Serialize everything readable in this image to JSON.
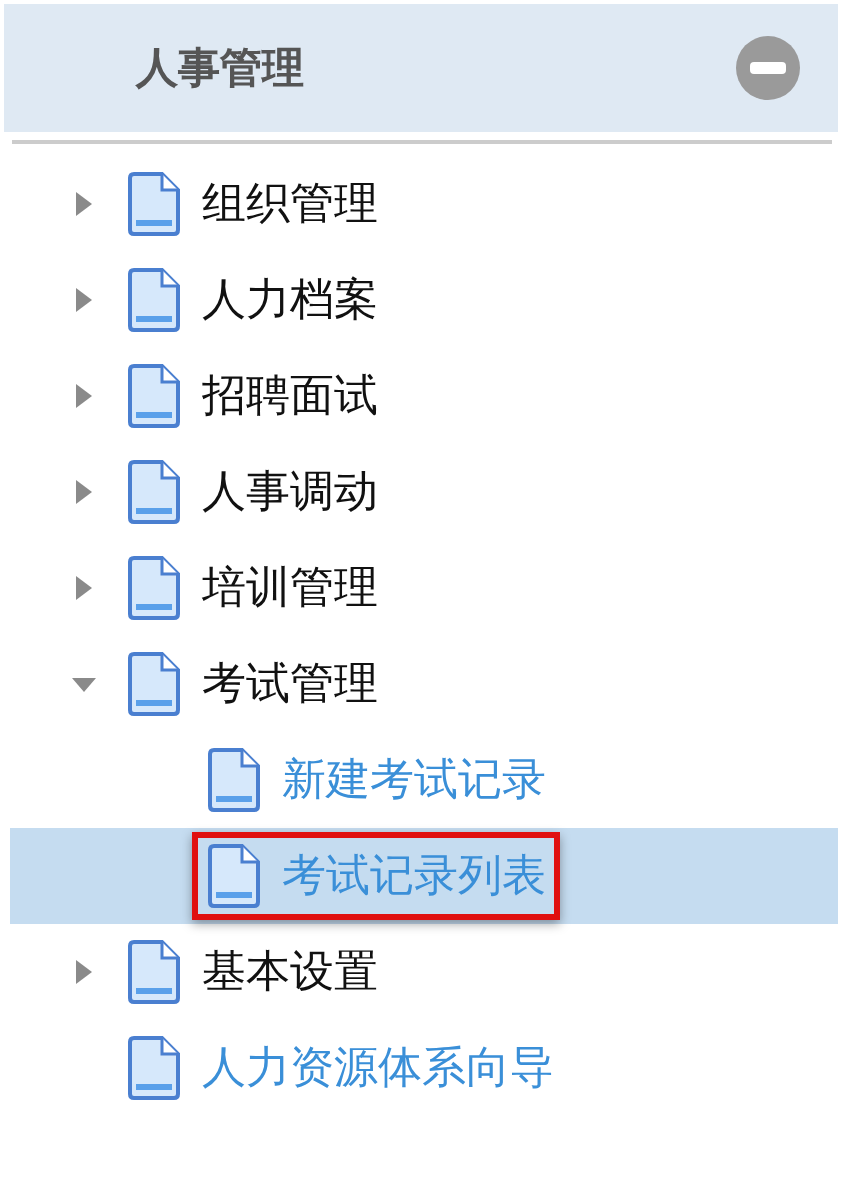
{
  "panel": {
    "title": "人事管理",
    "collapsed": false
  },
  "tree": [
    {
      "kind": "group",
      "label": "组织管理",
      "expanded": false,
      "selected": false,
      "highlighted": false
    },
    {
      "kind": "group",
      "label": "人力档案",
      "expanded": false,
      "selected": false,
      "highlighted": false
    },
    {
      "kind": "group",
      "label": "招聘面试",
      "expanded": false,
      "selected": false,
      "highlighted": false
    },
    {
      "kind": "group",
      "label": "人事调动",
      "expanded": false,
      "selected": false,
      "highlighted": false
    },
    {
      "kind": "group",
      "label": "培训管理",
      "expanded": false,
      "selected": false,
      "highlighted": false
    },
    {
      "kind": "group",
      "label": "考试管理",
      "expanded": true,
      "selected": false,
      "highlighted": false,
      "children": [
        {
          "kind": "leaf",
          "label": "新建考试记录",
          "selected": false,
          "highlighted": false
        },
        {
          "kind": "leaf",
          "label": "考试记录列表",
          "selected": true,
          "highlighted": true
        }
      ]
    },
    {
      "kind": "group",
      "label": "基本设置",
      "expanded": false,
      "selected": false,
      "highlighted": false
    },
    {
      "kind": "leaf",
      "label": "人力资源体系向导",
      "selected": false,
      "highlighted": false
    }
  ]
}
